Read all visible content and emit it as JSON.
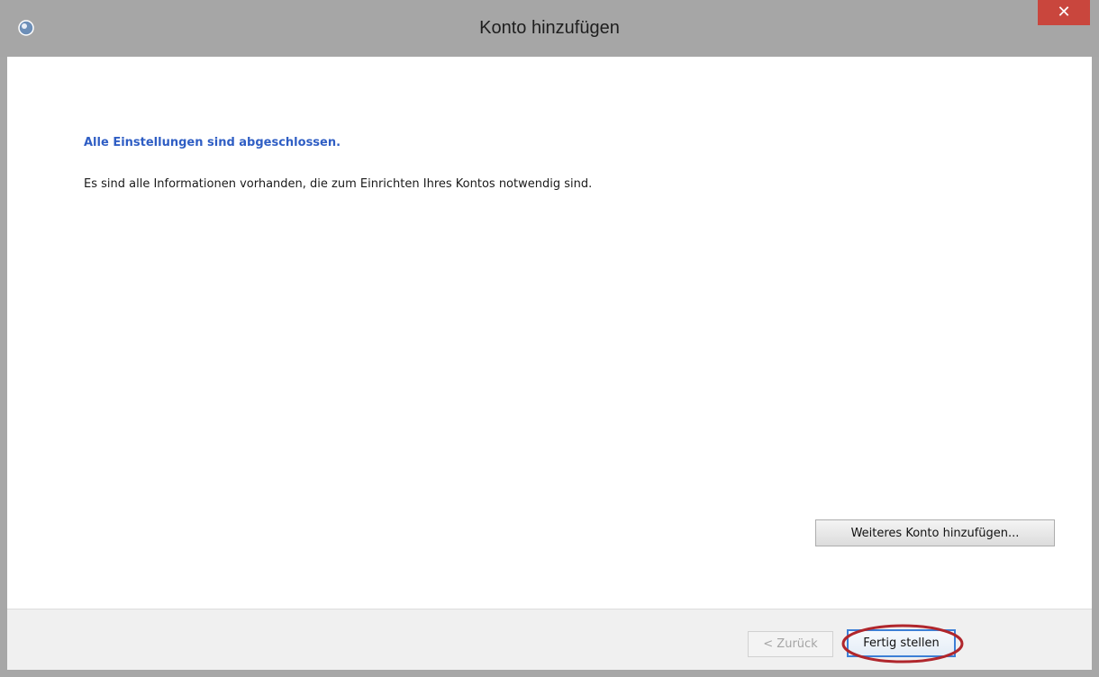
{
  "window": {
    "title": "Konto hinzufügen",
    "close_label": "✕"
  },
  "content": {
    "heading": "Alle Einstellungen sind abgeschlossen.",
    "message": "Es sind alle Informationen vorhanden, die zum Einrichten Ihres Kontos notwendig sind.",
    "add_account_label": "Weiteres Konto hinzufügen..."
  },
  "footer": {
    "back_label": "< Zurück",
    "finish_label": "Fertig stellen"
  },
  "icons": {
    "app": "outlook-account-icon",
    "close": "close-icon"
  },
  "colors": {
    "heading": "#2f5ec4",
    "close_button": "#c9463d",
    "highlight_ring": "#b0262c"
  }
}
